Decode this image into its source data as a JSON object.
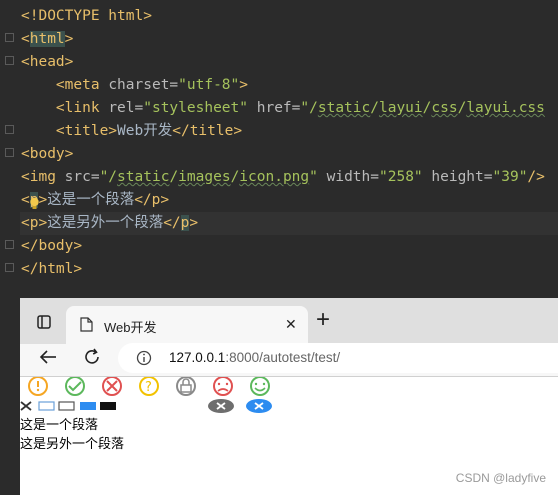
{
  "editor": {
    "lines": [
      {
        "parts": [
          [
            "tag",
            "<!DOCTYPE html>"
          ]
        ]
      },
      {
        "parts": [
          [
            "tag",
            "<"
          ],
          [
            "tagbg",
            "html"
          ],
          [
            "tag",
            ">"
          ]
        ]
      },
      {
        "parts": [
          [
            "tag",
            "<head>"
          ]
        ]
      },
      {
        "parts": [
          [
            "txt",
            "    "
          ],
          [
            "tag",
            "<meta "
          ],
          [
            "attr",
            "charset="
          ],
          [
            "val",
            "\"utf-8\""
          ],
          [
            "tag",
            ">"
          ]
        ]
      },
      {
        "parts": [
          [
            "txt",
            "    "
          ],
          [
            "tag",
            "<link "
          ],
          [
            "attr",
            "rel="
          ],
          [
            "val",
            "\"stylesheet\" "
          ],
          [
            "attr",
            "href="
          ],
          [
            "val",
            "\"/"
          ],
          [
            "valu",
            "static"
          ],
          [
            "val",
            "/"
          ],
          [
            "valu",
            "layui"
          ],
          [
            "val",
            "/"
          ],
          [
            "valu",
            "css"
          ],
          [
            "val",
            "/"
          ],
          [
            "valu",
            "layui.css"
          ]
        ]
      },
      {
        "parts": [
          [
            "txt",
            "    "
          ],
          [
            "tag",
            "<title>"
          ],
          [
            "txt",
            "Web开发"
          ],
          [
            "tag",
            "</title>"
          ]
        ]
      },
      {
        "parts": [
          [
            "tag",
            "<body>"
          ]
        ]
      },
      {
        "parts": [
          [
            "tag",
            "<img "
          ],
          [
            "attr",
            "src="
          ],
          [
            "val",
            "\"/"
          ],
          [
            "valu",
            "static"
          ],
          [
            "val",
            "/"
          ],
          [
            "valu",
            "images"
          ],
          [
            "val",
            "/"
          ],
          [
            "valu",
            "icon.png"
          ],
          [
            "val",
            "\" "
          ],
          [
            "attr",
            "width="
          ],
          [
            "val",
            "\"258\" "
          ],
          [
            "attr",
            "height="
          ],
          [
            "val",
            "\"39\""
          ],
          [
            "tag",
            "/>"
          ]
        ]
      },
      {
        "parts": [
          [
            "tag",
            "<"
          ],
          [
            "tagbg",
            "p"
          ],
          [
            "tag",
            ">"
          ],
          [
            "txt",
            "这是一个段落"
          ],
          [
            "tag",
            "</p>"
          ]
        ]
      },
      {
        "parts": [
          [
            "tag",
            "<p>"
          ],
          [
            "txt",
            "这是另外一个段落"
          ],
          [
            "tag",
            "</"
          ],
          [
            "tagbg",
            "p"
          ],
          [
            "tag",
            ">"
          ]
        ]
      },
      {
        "parts": [
          [
            "tag",
            "</body>"
          ]
        ]
      },
      {
        "parts": [
          [
            "tag",
            "</html>"
          ]
        ]
      }
    ]
  },
  "browser": {
    "tab_title": "Web开发",
    "tab_close": "✕",
    "new_tab": "+",
    "url_host": "127.0.0.1",
    "url_rest": ":8000/autotest/test/",
    "paragraphs": [
      "这是一个段落",
      "这是另外一个段落"
    ],
    "colors": {
      "orange": "#f5a623",
      "green": "#5cb85c",
      "red": "#e05050",
      "yellow": "#f2c200",
      "gray": "#8a8a8a",
      "blue": "#2d8cf0"
    }
  },
  "watermark": "CSDN @ladyfive"
}
